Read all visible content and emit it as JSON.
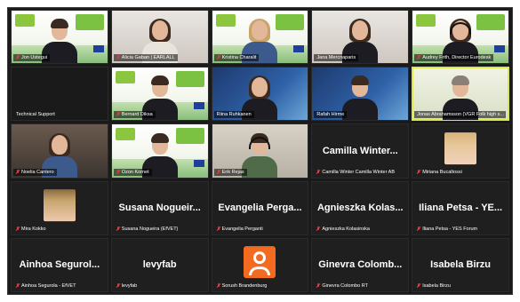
{
  "meeting": {
    "tiles": [
      {
        "id": "t1",
        "type": "video",
        "scene": "banner",
        "person": {
          "hair": "dark",
          "body": "dark"
        },
        "label": "Jon Ustegui",
        "muted": true
      },
      {
        "id": "t2",
        "type": "video",
        "scene": "room",
        "person": {
          "hair": "long",
          "body": "light"
        },
        "label": "Alicia Gaban | EARLALL",
        "muted": true
      },
      {
        "id": "t3",
        "type": "video",
        "scene": "banner",
        "person": {
          "hair": "long-blond",
          "body": "blue"
        },
        "label": "Kristina Charalit",
        "muted": true
      },
      {
        "id": "t4",
        "type": "video",
        "scene": "room",
        "person": {
          "hair": "long",
          "body": "dark"
        },
        "label": "Jana Mercnaparis",
        "muted": false
      },
      {
        "id": "t5",
        "type": "video",
        "scene": "banner",
        "person": {
          "hair": "long",
          "body": "dark",
          "headset": true
        },
        "label": "Audrey Frith, Director Eurodesk",
        "muted": true
      },
      {
        "id": "t6",
        "type": "name",
        "big": "",
        "label": "Technical Support",
        "muted": false,
        "blank": true
      },
      {
        "id": "t7",
        "type": "video",
        "scene": "banner",
        "person": {
          "hair": "dark",
          "body": "dark"
        },
        "label": "Bernard Diksa",
        "muted": true
      },
      {
        "id": "t8",
        "type": "video",
        "scene": "blue",
        "person": {
          "hair": "long",
          "body": "dark"
        },
        "label": "Riina Ruhkanen",
        "muted": false
      },
      {
        "id": "t9",
        "type": "video",
        "scene": "blue",
        "person": {
          "hair": "dark",
          "body": "dark"
        },
        "label": "Rafah Hirme",
        "muted": false
      },
      {
        "id": "t10",
        "type": "video",
        "scene": "greenlight",
        "person": {
          "hair": "grey",
          "body": "dark"
        },
        "label": "Jonas Abrahamsson (VGR Folk high s...",
        "muted": false,
        "active": true
      },
      {
        "id": "t11",
        "type": "video",
        "scene": "home",
        "person": {
          "hair": "long",
          "body": "blue"
        },
        "label": "Noelia Cantero",
        "muted": true
      },
      {
        "id": "t12",
        "type": "video",
        "scene": "banner",
        "person": {
          "hair": "dark",
          "body": "dark"
        },
        "label": "Ozon Kornet",
        "muted": true
      },
      {
        "id": "t13",
        "type": "video",
        "scene": "office",
        "person": {
          "hair": "dark",
          "body": "green",
          "headset": true
        },
        "label": "Erik Rejas",
        "muted": true
      },
      {
        "id": "t14",
        "type": "name",
        "big": "Camilla Winter...",
        "label": "Camilla Winter Camilla Winter AB",
        "muted": true
      },
      {
        "id": "t15",
        "type": "thumb",
        "thumb": "blonde",
        "label": "Miriana Bucaltossi",
        "muted": true
      },
      {
        "id": "t16",
        "type": "thumb",
        "thumb": "child",
        "label": "Mira Kokko",
        "muted": true
      },
      {
        "id": "t17",
        "type": "name",
        "big": "Susana Nogueir...",
        "label": "Susana Nogueira (EfVET)",
        "muted": true
      },
      {
        "id": "t18",
        "type": "name",
        "big": "Evangelia Perga...",
        "label": "Evangelia Perganti",
        "muted": true
      },
      {
        "id": "t19",
        "type": "name",
        "big": "Agnieszka Kolas...",
        "label": "Agnieszka Kolasinska",
        "muted": true
      },
      {
        "id": "t20",
        "type": "name",
        "big": "Iliana Petsa - YE...",
        "label": "Iliana Petsa - YES Forum",
        "muted": true
      },
      {
        "id": "t21",
        "type": "name",
        "big": "Ainhoa Segurol...",
        "label": "Ainhoa Segurola - EfVET",
        "muted": true
      },
      {
        "id": "t22",
        "type": "name",
        "big": "levyfab",
        "label": "levyfab",
        "muted": true
      },
      {
        "id": "t23",
        "type": "avatar",
        "label": "Sorush Brandenburg",
        "muted": true
      },
      {
        "id": "t24",
        "type": "name",
        "big": "Ginevra Colomb...",
        "label": "Ginevra Colombo RT",
        "muted": true
      },
      {
        "id": "t25",
        "type": "name",
        "big": "Isabela Birzu",
        "label": "Isabela Birzu",
        "muted": true
      }
    ]
  },
  "colors": {
    "active_speaker_outline": "#d9e84a",
    "muted_mic": "#e03a3a",
    "default_avatar": "#f26b21"
  }
}
